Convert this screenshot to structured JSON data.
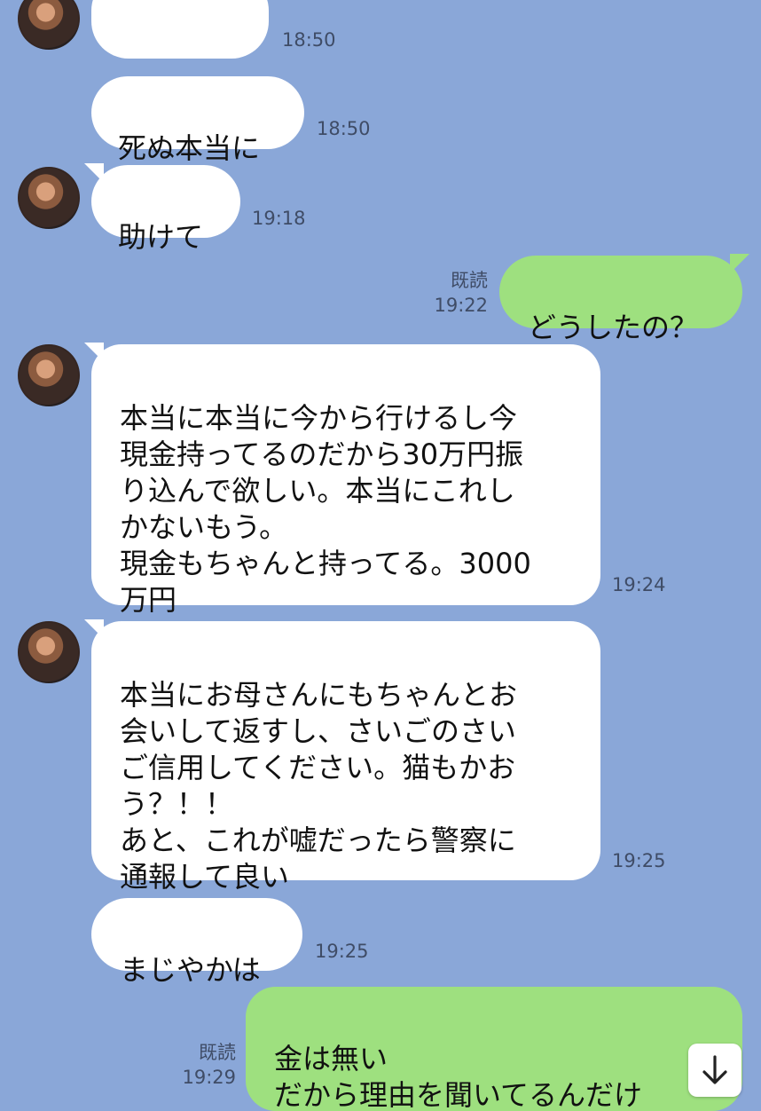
{
  "messages": [
    {
      "id": "m0",
      "side": "in",
      "text": "",
      "time": "18:50"
    },
    {
      "id": "m1",
      "side": "in",
      "text": "死ぬ本当に",
      "time": "18:50"
    },
    {
      "id": "m2",
      "side": "in",
      "text": "助けて",
      "time": "19:18"
    },
    {
      "id": "m3",
      "side": "out",
      "text": "どうしたの？",
      "read": "既読",
      "time": "19:22"
    },
    {
      "id": "m4",
      "side": "in",
      "text": "本当に本当に今から行けるし今\n現金持ってるのだから30万円振\nり込んで欲しい。本当にこれし\nかないもう。\n現金もちゃんと持ってる。3000\n万円",
      "time": "19:24"
    },
    {
      "id": "m5",
      "side": "in",
      "text": "本当にお母さんにもちゃんとお\n会いして返すし、さいごのさい\nご信用してください。猫もかお\nう？！！\nあと、これが嘘だったら警察に\n通報して良い",
      "time": "19:25"
    },
    {
      "id": "m6",
      "side": "in",
      "text": "まじやかは",
      "time": "19:25"
    },
    {
      "id": "m7",
      "side": "out",
      "text": "金は無い\nだから理由を聞いてるんだけ",
      "read": "既読",
      "time": "19:29"
    }
  ],
  "scroll_button": {
    "icon": "arrow-down-icon",
    "glyph": "↓"
  }
}
